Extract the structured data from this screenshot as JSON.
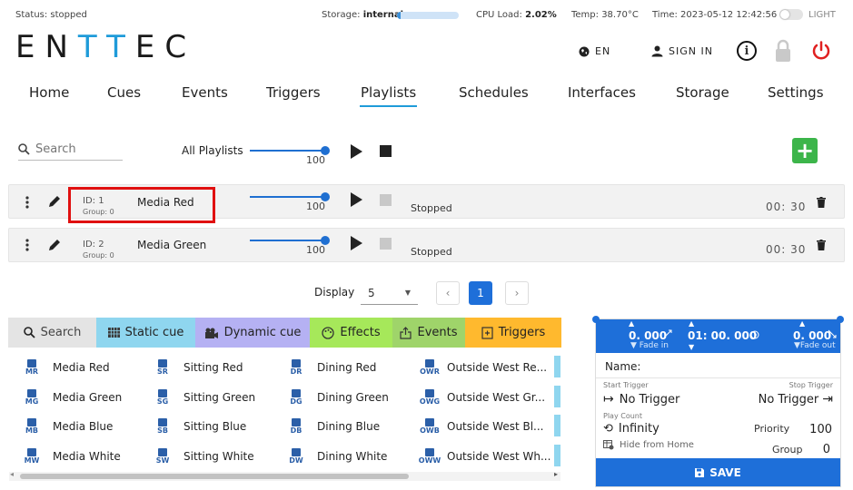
{
  "status_bar": {
    "status": "Status: stopped",
    "storage_label": "Storage:",
    "storage_value": "internal",
    "storage_fill": 0.06,
    "cpu_label": "CPU Load:",
    "cpu_value": "2.02%",
    "temp": "Temp: 38.70°C",
    "time": "Time: 2023-05-12 12:42:56",
    "theme_label": "LIGHT"
  },
  "brand": {
    "logo_dark1": "EN",
    "logo_blue": "TT",
    "logo_dark2": "EC"
  },
  "header_actions": {
    "language": "EN",
    "sign_in": "SIGN IN"
  },
  "nav": {
    "items": [
      "Home",
      "Cues",
      "Events",
      "Triggers",
      "Playlists",
      "Schedules",
      "Interfaces",
      "Storage",
      "Settings"
    ],
    "active": "Playlists"
  },
  "toolbar": {
    "search_placeholder": "Search",
    "all_playlists_label": "All Playlists",
    "master_level": "100",
    "master_fill": 1.0
  },
  "playlists": [
    {
      "id_label": "ID:",
      "id": "1",
      "group": "Group: 0",
      "name": "Media Red",
      "level": "100",
      "status": "Stopped",
      "time": "00: 30"
    },
    {
      "id_label": "ID:",
      "id": "2",
      "group": "Group: 0",
      "name": "Media Green",
      "level": "100",
      "status": "Stopped",
      "time": "00: 30"
    }
  ],
  "pagination": {
    "display_label": "Display",
    "page_size": "5",
    "current_page": "1"
  },
  "cue_tabs": [
    {
      "label": "Search",
      "icon": "search-icon",
      "color": "#e4e4e4"
    },
    {
      "label": "Static cue",
      "icon": "grid-icon",
      "color": "#8fd6ef"
    },
    {
      "label": "Dynamic cue",
      "icon": "camera-icon",
      "color": "#b5b1f3"
    },
    {
      "label": "Effects",
      "icon": "palette-icon",
      "color": "#a6e85a"
    },
    {
      "label": "Events",
      "icon": "export-icon",
      "color": "#9fd46a"
    },
    {
      "label": "Triggers",
      "icon": "trigger-icon",
      "color": "#ffb92e"
    }
  ],
  "cues": [
    [
      {
        "abbr": "MR",
        "name": "Media Red"
      },
      {
        "abbr": "MG",
        "name": "Media Green"
      },
      {
        "abbr": "MB",
        "name": "Media Blue"
      },
      {
        "abbr": "MW",
        "name": "Media White"
      }
    ],
    [
      {
        "abbr": "SR",
        "name": "Sitting Red"
      },
      {
        "abbr": "SG",
        "name": "Sitting Green"
      },
      {
        "abbr": "SB",
        "name": "Sitting Blue"
      },
      {
        "abbr": "SW",
        "name": "Sitting White"
      }
    ],
    [
      {
        "abbr": "DR",
        "name": "Dining Red"
      },
      {
        "abbr": "DG",
        "name": "Dining Green"
      },
      {
        "abbr": "DB",
        "name": "Dining Blue"
      },
      {
        "abbr": "DW",
        "name": "Dining White"
      }
    ],
    [
      {
        "abbr": "OWR",
        "name": "Outside West Re..."
      },
      {
        "abbr": "OWG",
        "name": "Outside West Gr..."
      },
      {
        "abbr": "OWB",
        "name": "Outside West Bl..."
      },
      {
        "abbr": "OWW",
        "name": "Outside West Wh..."
      }
    ]
  ],
  "editor": {
    "fade_in": "0. 000",
    "fade_in_label": "Fade in",
    "duration": "01: 00. 000",
    "fade_out": "0. 000",
    "fade_out_label": "Fade out",
    "name_label": "Name:",
    "start_trigger_label": "Start Trigger",
    "start_trigger_value": "No Trigger",
    "stop_trigger_label": "Stop Trigger",
    "stop_trigger_value": "No Trigger",
    "play_count_label": "Play Count",
    "play_count_value": "Infinity",
    "priority_label": "Priority",
    "priority_value": "100",
    "hide_label": "Hide from Home",
    "group_label": "Group",
    "group_value": "0",
    "save_label": "SAVE"
  }
}
